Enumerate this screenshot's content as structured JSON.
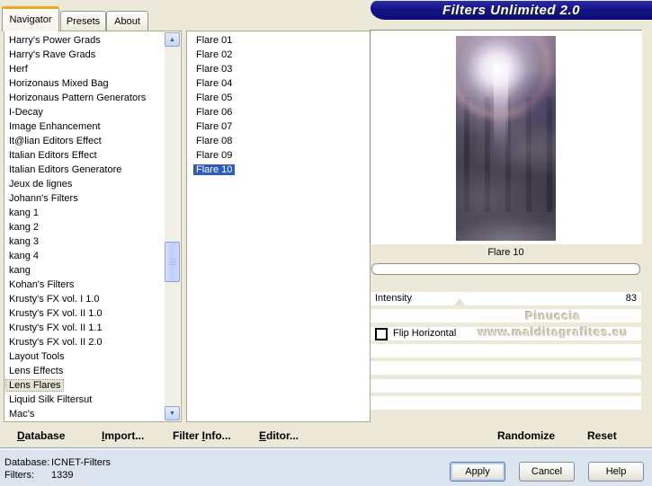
{
  "window": {
    "title": "Filters Unlimited 2.0"
  },
  "tabs": {
    "navigator": "Navigator",
    "presets": "Presets",
    "about": "About"
  },
  "category_list": {
    "selected": "Lens Flares",
    "selection_class": "sel-inactive",
    "items": [
      "Harry's Power Grads",
      "Harry's Rave Grads",
      "Herf",
      "Horizonaus Mixed Bag",
      "Horizonaus Pattern Generators",
      "I-Decay",
      "Image Enhancement",
      "It@lian Editors Effect",
      "Italian Editors Effect",
      "Italian Editors Generatore",
      "Jeux de lignes",
      "Johann's Filters",
      "kang 1",
      "kang 2",
      "kang 3",
      "kang 4",
      "kang",
      "Kohan's Filters",
      "Krusty's FX vol. I 1.0",
      "Krusty's FX vol. II 1.0",
      "Krusty's FX vol. II 1.1",
      "Krusty's FX vol. II 2.0",
      "Layout Tools",
      "Lens Effects",
      "Lens Flares",
      "Liquid Silk Filtersut",
      "Mac's"
    ]
  },
  "filter_list": {
    "selected": "Flare 10",
    "selection_class": "sel-active",
    "items": [
      "Flare 01",
      "Flare 02",
      "Flare 03",
      "Flare 04",
      "Flare 05",
      "Flare 06",
      "Flare 07",
      "Flare 08",
      "Flare 09",
      "Flare 10"
    ]
  },
  "preview": {
    "caption": "Flare 10"
  },
  "controls": {
    "intensity_label": "Intensity",
    "intensity_value": "83",
    "flip_label": "Flip Horizontal",
    "watermark_line1": "Pinuccia",
    "watermark_line2": "www.malditagrafites.eu"
  },
  "toolbar": {
    "database": {
      "label": "Database",
      "underline": 0
    },
    "import": {
      "label": "Import...",
      "underline": 0
    },
    "filter_info": {
      "label": "Filter Info...",
      "underline": 7
    },
    "editor": {
      "label": "Editor...",
      "underline": 0
    },
    "randomize": "Randomize",
    "reset": "Reset"
  },
  "statusbar": {
    "database_label": "Database:",
    "database_value": "ICNET-Filters",
    "filters_label": "Filters:",
    "filters_value": "1339"
  },
  "buttons": {
    "apply": "Apply",
    "cancel": "Cancel",
    "help": "Help"
  },
  "icons": {
    "scroll_up": "▲",
    "scroll_down": "▼"
  },
  "colors": {
    "selection": "#2f5bc0",
    "banner": "#10107e",
    "tab_accent": "#f3a522",
    "dialog_bg": "#ece9d8",
    "statusbar_bg": "#dce5ef"
  }
}
